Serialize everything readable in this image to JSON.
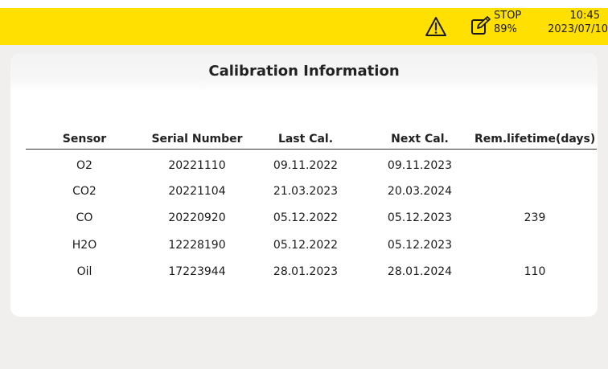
{
  "status": {
    "stop_label": "STOP",
    "battery": "89%",
    "time": "10:45",
    "date": "2023/07/10",
    "icons": [
      "warning-icon",
      "edit-icon"
    ],
    "accent_color": "#ffe000"
  },
  "page": {
    "title": "Calibration Information"
  },
  "table": {
    "columns": [
      "Sensor",
      "Serial Number",
      "Last Cal.",
      "Next Cal.",
      "Rem.lifetime(days)"
    ],
    "rows": [
      [
        "O2",
        "20221110",
        "09.11.2022",
        "09.11.2023",
        ""
      ],
      [
        "CO2",
        "20221104",
        "21.03.2023",
        "20.03.2024",
        ""
      ],
      [
        "CO",
        "20220920",
        "05.12.2022",
        "05.12.2023",
        "239"
      ],
      [
        "H2O",
        "12228190",
        "05.12.2022",
        "05.12.2023",
        ""
      ],
      [
        "Oil",
        "17223944",
        "28.01.2023",
        "28.01.2024",
        "110"
      ]
    ]
  }
}
